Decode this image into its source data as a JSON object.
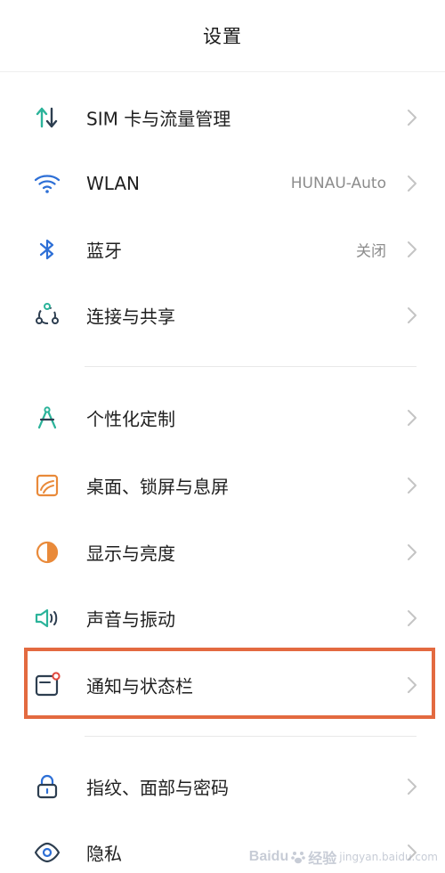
{
  "header": {
    "title": "设置"
  },
  "groups": [
    {
      "items": [
        {
          "label": "SIM 卡与流量管理",
          "value": "",
          "icon": "sim-data-icon"
        },
        {
          "label": "WLAN",
          "value": "HUNAU-Auto",
          "icon": "wifi-icon"
        },
        {
          "label": "蓝牙",
          "value": "关闭",
          "icon": "bluetooth-icon"
        },
        {
          "label": "连接与共享",
          "value": "",
          "icon": "connection-share-icon"
        }
      ]
    },
    {
      "items": [
        {
          "label": "个性化定制",
          "value": "",
          "icon": "personalization-icon"
        },
        {
          "label": "桌面、锁屏与息屏",
          "value": "",
          "icon": "wallpaper-icon"
        },
        {
          "label": "显示与亮度",
          "value": "",
          "icon": "brightness-icon"
        },
        {
          "label": "声音与振动",
          "value": "",
          "icon": "sound-icon"
        },
        {
          "label": "通知与状态栏",
          "value": "",
          "icon": "notification-icon"
        }
      ]
    },
    {
      "items": [
        {
          "label": "指纹、面部与密码",
          "value": "",
          "icon": "lock-icon"
        },
        {
          "label": "隐私",
          "value": "",
          "icon": "privacy-eye-icon"
        }
      ]
    }
  ],
  "highlight_color": "#e36a40",
  "watermark": {
    "brand": "Baidu",
    "brand_suffix": "经验",
    "url": "jingyan.baidu.com"
  }
}
